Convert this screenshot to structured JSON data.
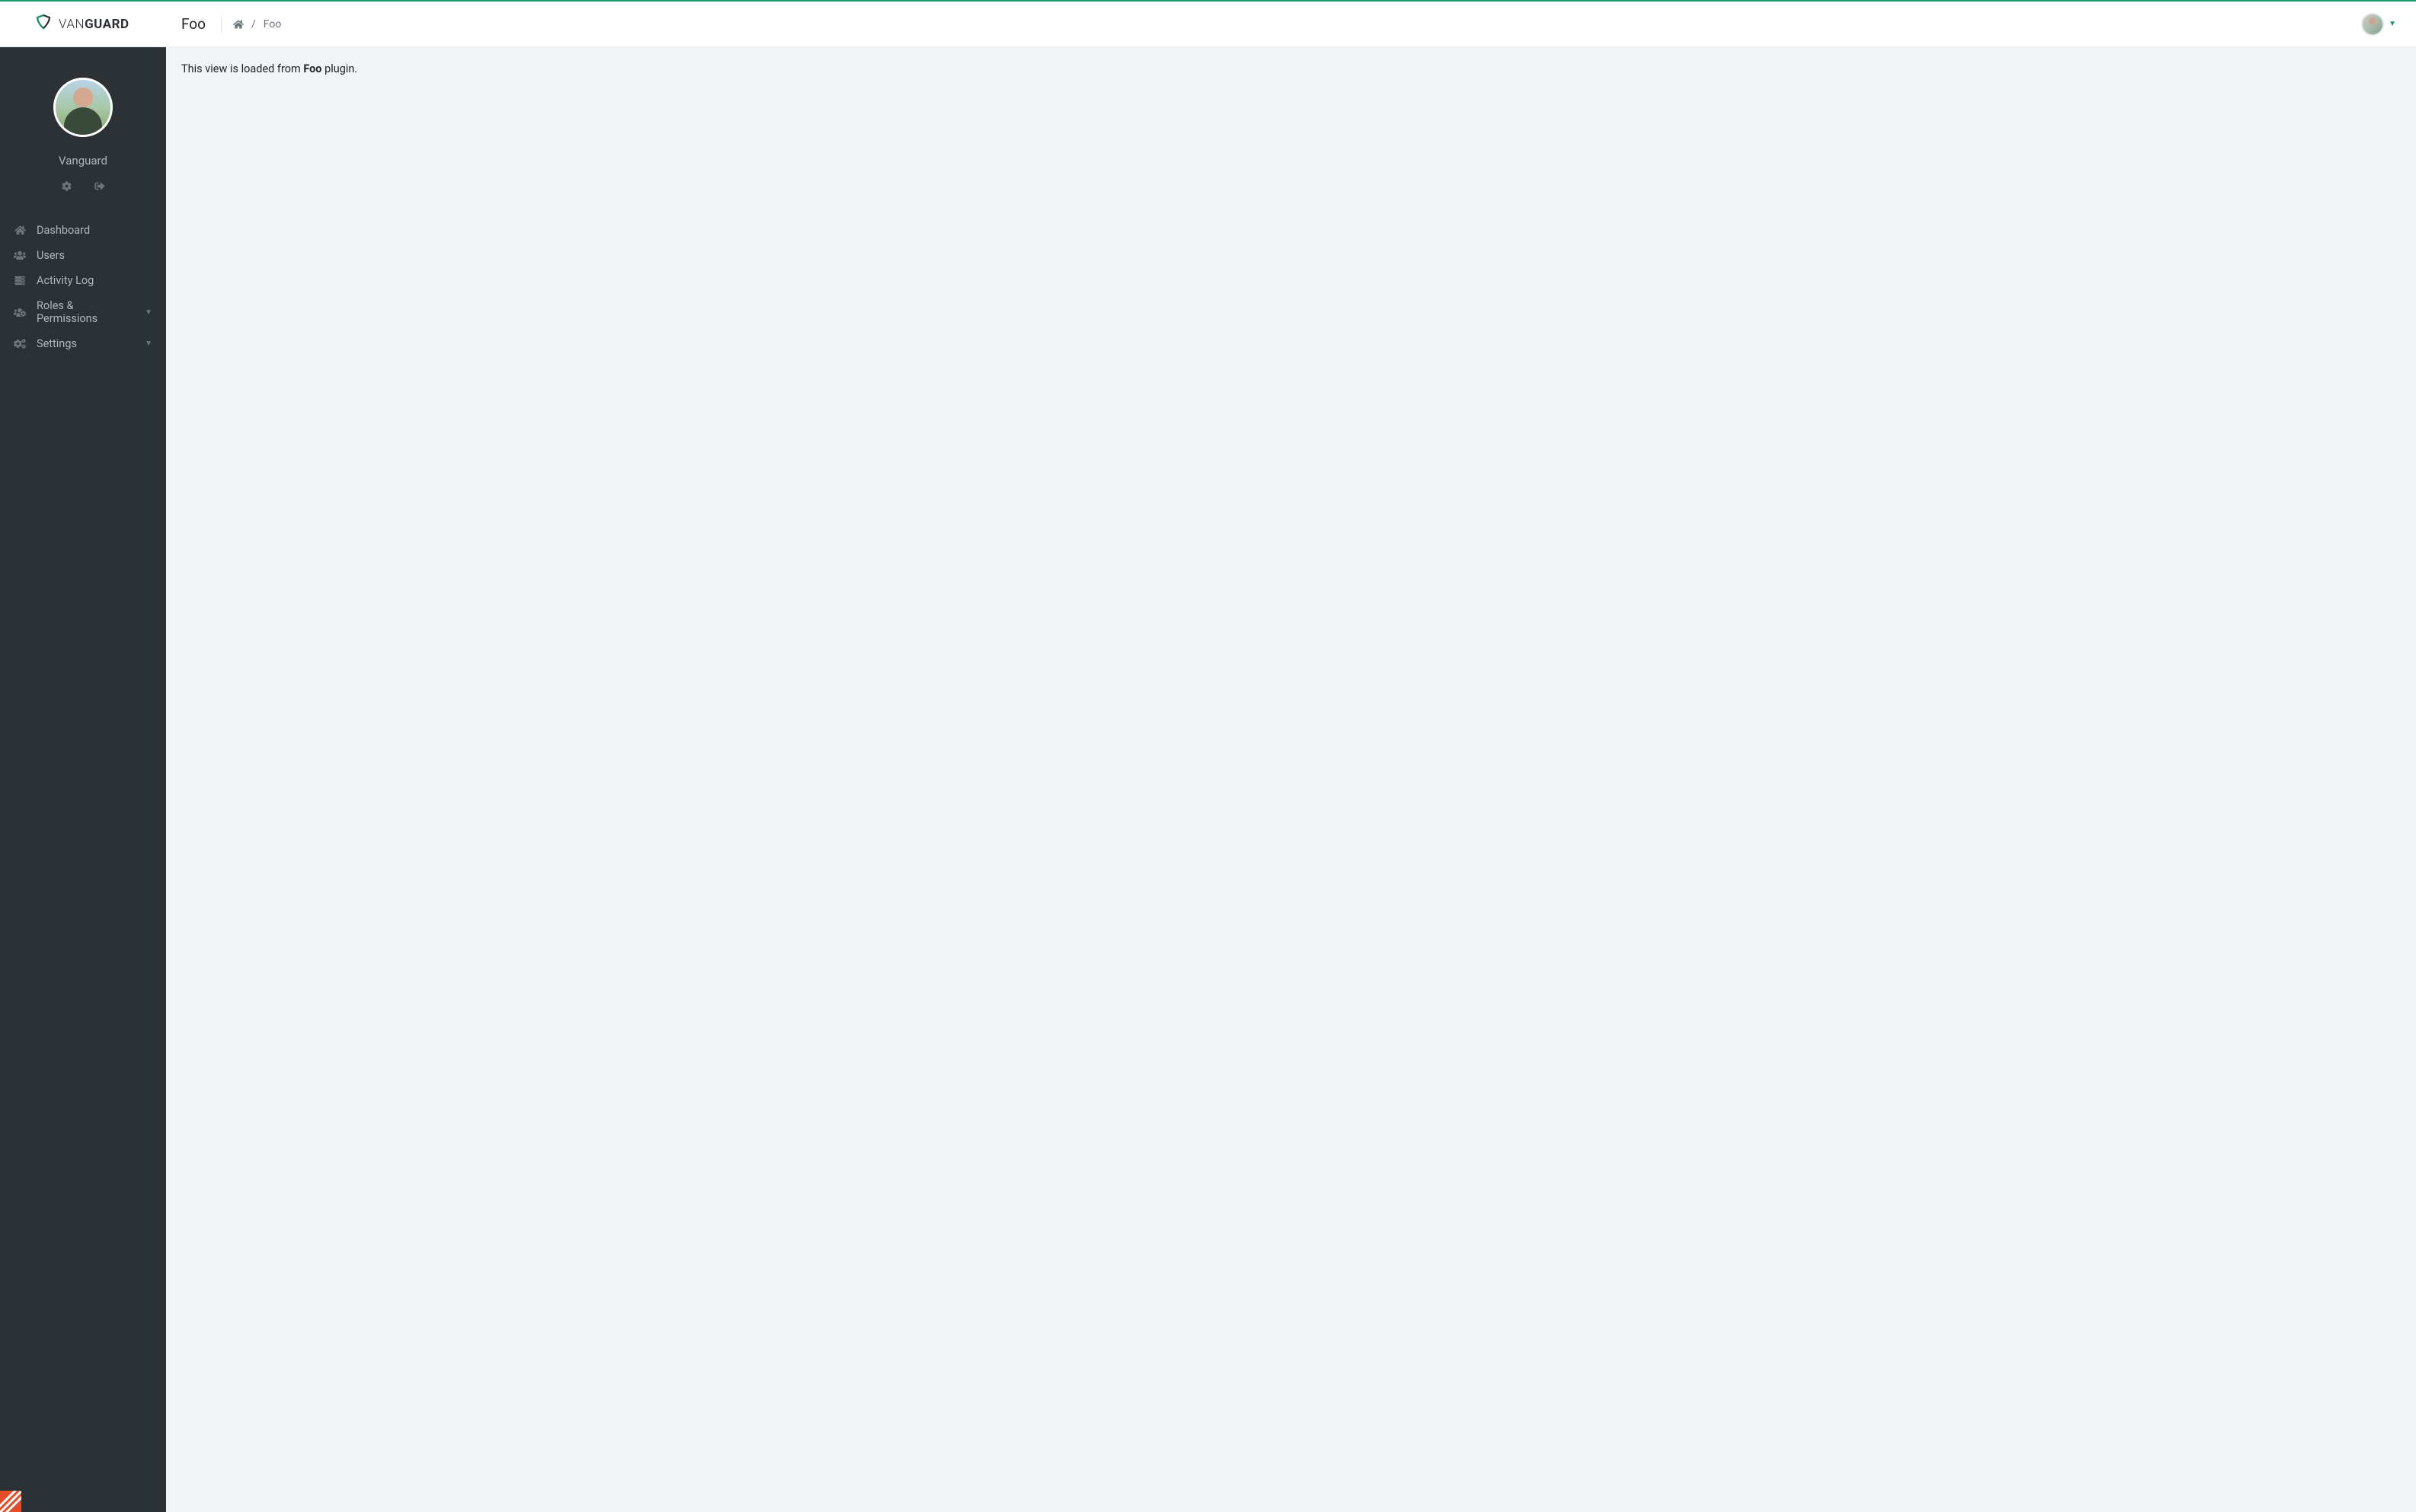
{
  "brand": {
    "light": "VAN",
    "bold": "GUARD"
  },
  "header": {
    "title": "Foo"
  },
  "breadcrumb": {
    "separator": "/",
    "current": "Foo"
  },
  "sidebar": {
    "username": "Vanguard",
    "nav": [
      {
        "label": "Dashboard",
        "icon": "home",
        "expandable": false
      },
      {
        "label": "Users",
        "icon": "users",
        "expandable": false
      },
      {
        "label": "Activity Log",
        "icon": "server",
        "expandable": false
      },
      {
        "label": "Roles & Permissions",
        "icon": "users-cog",
        "expandable": true
      },
      {
        "label": "Settings",
        "icon": "cogs",
        "expandable": true
      }
    ]
  },
  "main": {
    "text_prefix": "This view is loaded from ",
    "text_bold": "Foo",
    "text_suffix": " plugin."
  },
  "colors": {
    "accent": "#179970",
    "sidebar_bg": "#2c3136",
    "content_bg": "#f1f4f6"
  }
}
